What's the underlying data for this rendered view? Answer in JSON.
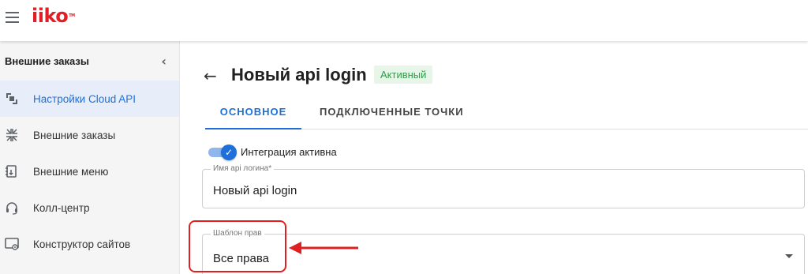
{
  "app": {
    "logo_text": "iiko",
    "logo_tm": "TM",
    "brand_color": "#e31e24"
  },
  "sidebar": {
    "section_title": "Внешние заказы",
    "items": [
      {
        "label": "Настройки Cloud API",
        "icon": "cloud-settings-icon",
        "active": true
      },
      {
        "label": "Внешние заказы",
        "icon": "external-orders-icon",
        "active": false
      },
      {
        "label": "Внешние меню",
        "icon": "external-menu-icon",
        "active": false
      },
      {
        "label": "Колл-центр",
        "icon": "headset-icon",
        "active": false
      },
      {
        "label": "Конструктор сайтов",
        "icon": "site-builder-icon",
        "active": false
      }
    ]
  },
  "page": {
    "title": "Новый api login",
    "status_badge": "Активный",
    "tabs": [
      {
        "label": "ОСНОВНОЕ",
        "active": true
      },
      {
        "label": "ПОДКЛЮЧЕННЫЕ ТОЧКИ",
        "active": false
      }
    ],
    "integration_toggle": {
      "label": "Интеграция активна",
      "checked": true
    },
    "fields": {
      "api_login_name": {
        "label": "Имя api логина*",
        "value": "Новый api login"
      },
      "rights_template": {
        "label": "Шаблон прав",
        "value": "Все права"
      }
    }
  },
  "colors": {
    "accent": "#1e6fd9",
    "active_badge_bg": "#e8f5e9",
    "active_badge_text": "#2e9e48",
    "annotation": "#e02020"
  }
}
